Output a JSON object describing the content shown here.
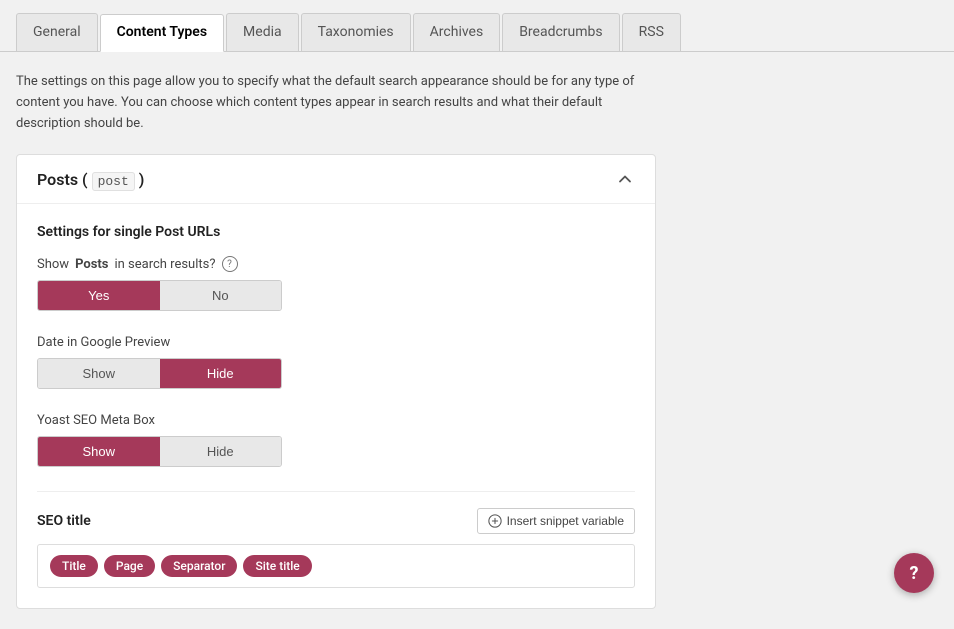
{
  "tabs": [
    {
      "id": "general",
      "label": "General",
      "active": false
    },
    {
      "id": "content-types",
      "label": "Content Types",
      "active": true
    },
    {
      "id": "media",
      "label": "Media",
      "active": false
    },
    {
      "id": "taxonomies",
      "label": "Taxonomies",
      "active": false
    },
    {
      "id": "archives",
      "label": "Archives",
      "active": false
    },
    {
      "id": "breadcrumbs",
      "label": "Breadcrumbs",
      "active": false
    },
    {
      "id": "rss",
      "label": "RSS",
      "active": false
    }
  ],
  "description": "The settings on this page allow you to specify what the default search appearance should be for any type of content you have. You can choose which content types appear in search results and what their default description should be.",
  "panel": {
    "title": "Posts",
    "code": "post",
    "sections_heading": "Settings for single Post URLs",
    "fields": [
      {
        "id": "show-in-search",
        "label_prefix": "Show ",
        "label_bold": "Posts",
        "label_suffix": " in search results?",
        "has_help": true,
        "toggle": {
          "options": [
            "Yes",
            "No"
          ],
          "active": "Yes"
        }
      },
      {
        "id": "date-in-google",
        "label": "Date in Google Preview",
        "toggle": {
          "options": [
            "Show",
            "Hide"
          ],
          "active": "Hide"
        }
      },
      {
        "id": "yoast-meta-box",
        "label": "Yoast SEO Meta Box",
        "toggle": {
          "options": [
            "Show",
            "Hide"
          ],
          "active": "Show"
        }
      }
    ],
    "seo_title": {
      "label": "SEO title",
      "insert_button": "Insert snippet variable",
      "tags": [
        "Title",
        "Page",
        "Separator",
        "Site title"
      ]
    }
  },
  "fab_label": "?",
  "accent_color": "#a5395a"
}
